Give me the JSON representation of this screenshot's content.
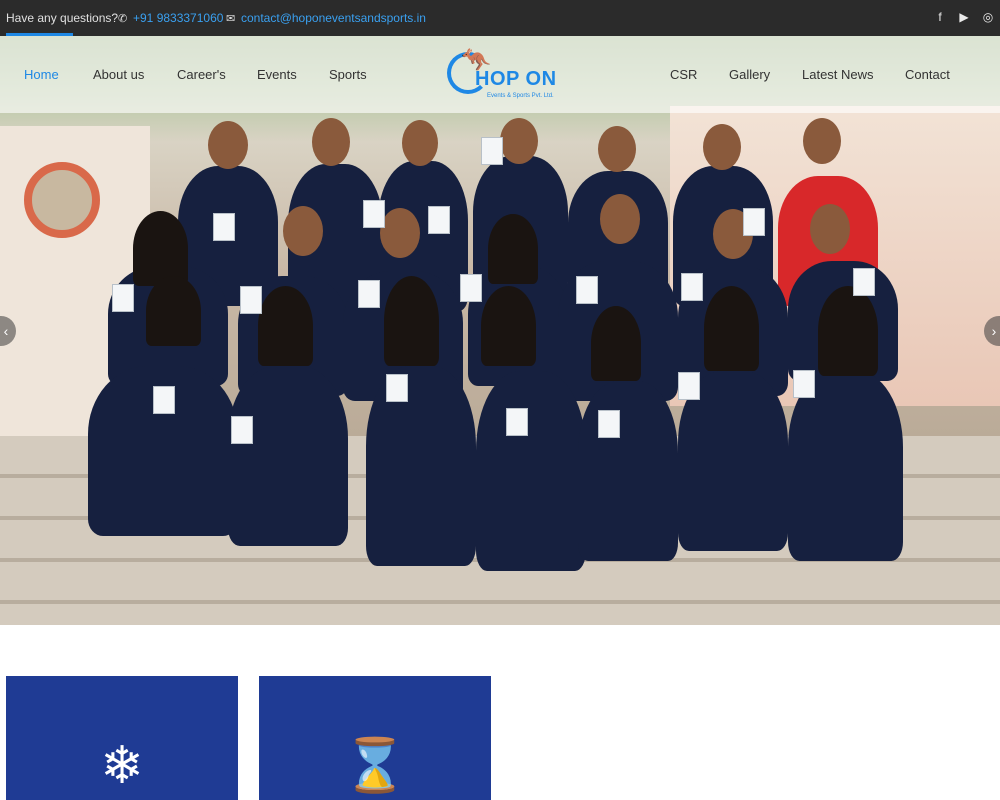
{
  "topbar": {
    "question": "Have any questions?",
    "phone": "+91 9833371060",
    "email": "contact@hoponeventsandsports.in",
    "social_icons": [
      "facebook-icon",
      "youtube-icon",
      "instagram-icon"
    ]
  },
  "nav": {
    "left": [
      "Home",
      "About us",
      "Career's",
      "Events",
      "Sports"
    ],
    "right": [
      "CSR",
      "Gallery",
      "Latest News",
      "Contact"
    ],
    "active": "Home"
  },
  "logo": {
    "name": "HOP ON",
    "tagline": "Events & Sports Pvt. Ltd."
  },
  "slider": {
    "prev": "‹",
    "next": "›"
  },
  "feature_boxes": [
    {
      "icon": "snowflake-icon",
      "glyph": "❄"
    },
    {
      "icon": "hourglass-icon",
      "glyph": "⌛"
    }
  ],
  "colors": {
    "accent": "#1e88e5",
    "topbar": "#2b2b2b",
    "feature_box": "#1f3b94"
  }
}
